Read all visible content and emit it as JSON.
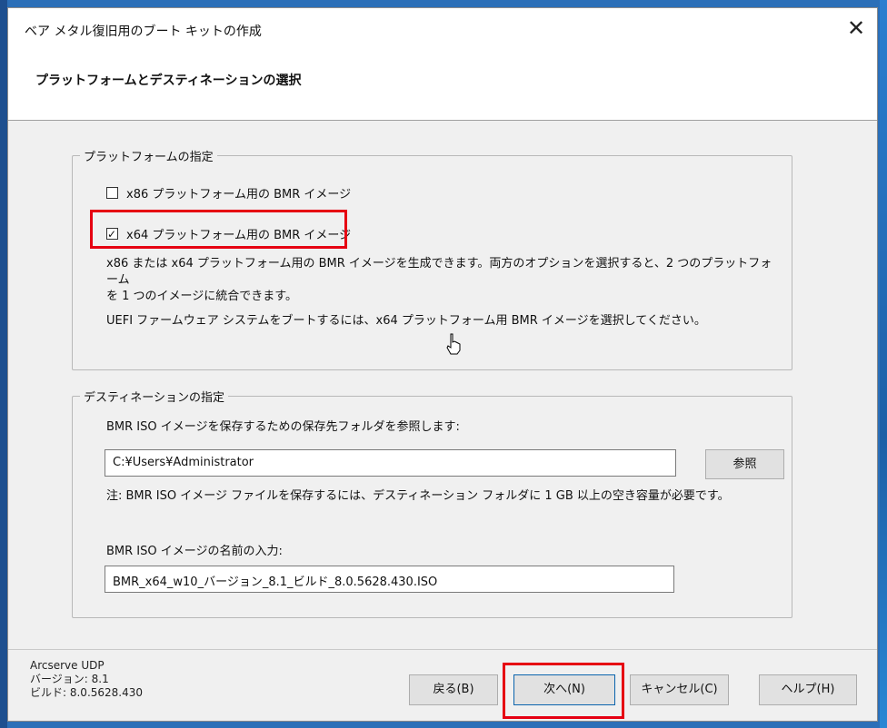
{
  "window": {
    "title": "ベア メタル復旧用のブート キットの作成",
    "close_glyph": "✕"
  },
  "header": {
    "title": "プラットフォームとデスティネーションの選択"
  },
  "platform": {
    "legend": "プラットフォームの指定",
    "x86": {
      "label": "x86 プラットフォーム用の BMR イメージ",
      "checked": false
    },
    "x64": {
      "label": "x64 プラットフォーム用の BMR イメージ",
      "checked": true,
      "check_glyph": "✓"
    },
    "desc1_line1": "x86 または x64 プラットフォーム用の BMR イメージを生成できます。両方のオプションを選択すると、2 つのプラットフォーム",
    "desc1_line2": "を 1 つのイメージに統合できます。",
    "desc2": "UEFI ファームウェア システムをブートするには、x64 プラットフォーム用 BMR イメージを選択してください。"
  },
  "destination": {
    "legend": "デスティネーションの指定",
    "browse_label": "BMR ISO イメージを保存するための保存先フォルダを参照します:",
    "folder_value": "C:¥Users¥Administrator",
    "browse_button": "参照",
    "note": "注: BMR ISO イメージ ファイルを保存するには、デスティネーション フォルダに 1 GB 以上の空き容量が必要です。",
    "name_label": "BMR ISO イメージの名前の入力:",
    "name_value": "BMR_x64_w10_バージョン_8.1_ビルド_8.0.5628.430.ISO"
  },
  "footer": {
    "product_name": "Arcserve UDP",
    "version": "バージョン: 8.1",
    "build": "ビルド: 8.0.5628.430",
    "back_button": "戻る(B)",
    "next_button": "次へ(N)",
    "cancel_button": "キャンセル(C)",
    "help_button": "ヘルプ(H)"
  },
  "colors": {
    "highlight": "#e60012",
    "desktop": "#2b6fb8",
    "dialog_bg": "#f0f0f0"
  }
}
